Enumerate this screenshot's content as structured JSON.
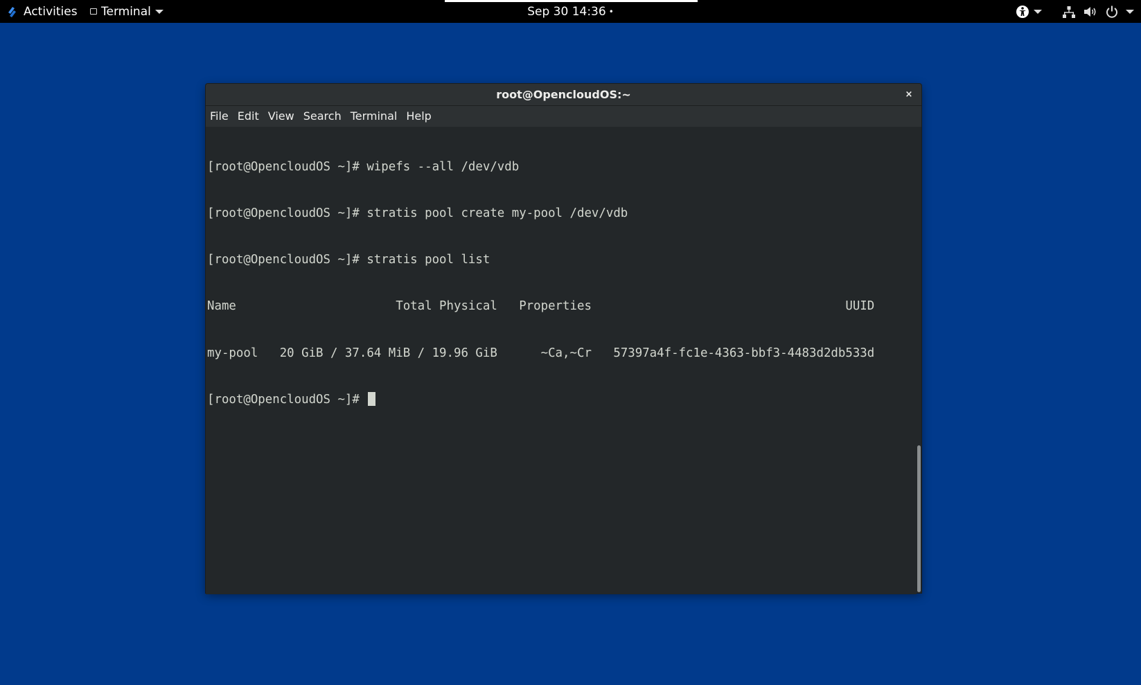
{
  "topbar": {
    "activities_label": "Activities",
    "app_menu_label": "Terminal",
    "clock": "Sep 30  14:36",
    "clock_indicator": "•",
    "icons": [
      "fedora-logo-icon",
      "accessibility-icon",
      "network-icon",
      "volume-icon",
      "power-icon"
    ]
  },
  "window": {
    "title": "root@OpencloudOS:~",
    "close_glyph": "×",
    "menu": [
      "File",
      "Edit",
      "View",
      "Search",
      "Terminal",
      "Help"
    ]
  },
  "terminal": {
    "lines": [
      "[root@OpencloudOS ~]# wipefs --all /dev/vdb",
      "[root@OpencloudOS ~]# stratis pool create my-pool /dev/vdb",
      "[root@OpencloudOS ~]# stratis pool list",
      "Name                      Total Physical   Properties                                   UUID",
      "my-pool   20 GiB / 37.64 MiB / 19.96 GiB      ~Ca,~Cr   57397a4f-fc1e-4363-bbf3-4483d2db533d"
    ],
    "prompt": "[root@OpencloudOS ~]#"
  },
  "colors": {
    "desktop_bg": "#013a8c",
    "terminal_bg": "#232729",
    "terminal_fg": "#d3d7cf"
  }
}
